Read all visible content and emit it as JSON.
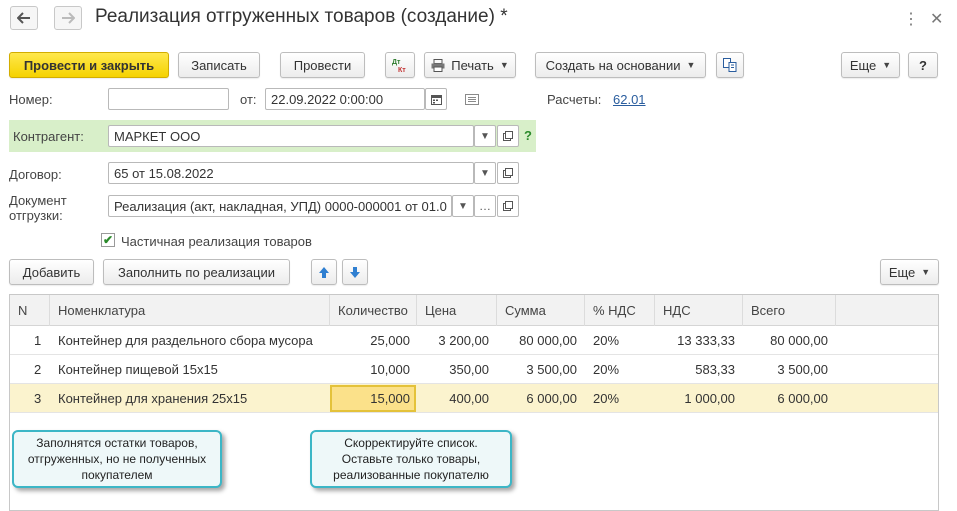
{
  "window": {
    "title": "Реализация отгруженных товаров (создание) *"
  },
  "toolbar": {
    "post_close": "Провести и закрыть",
    "save": "Записать",
    "post": "Провести",
    "dt_kt": "Дт Кт",
    "print": "Печать",
    "create_based": "Создать на основании",
    "more": "Еще",
    "help": "?"
  },
  "form": {
    "number_label": "Номер:",
    "number_value": "",
    "from_label": "от:",
    "date_value": "22.09.2022  0:00:00",
    "settlements_label": "Расчеты:",
    "settlements_value": "62.01",
    "counterparty_label": "Контрагент:",
    "counterparty_value": "МАРКЕТ ООО",
    "help_mark": "?",
    "contract_label": "Договор:",
    "contract_value": "65 от 15.08.2022",
    "shipdoc_label_1": "Документ",
    "shipdoc_label_2": "отгрузки:",
    "shipdoc_value": "Реализация (акт, накладная, УПД) 0000-000001 от 01.0",
    "partial_label": "Частичная реализация товаров",
    "partial_checked": true
  },
  "table_toolbar": {
    "add": "Добавить",
    "fill": "Заполнить по реализации",
    "more": "Еще"
  },
  "table": {
    "columns": [
      "N",
      "Номенклатура",
      "Количество",
      "Цена",
      "Сумма",
      "% НДС",
      "НДС",
      "Всего"
    ],
    "rows": [
      {
        "n": "1",
        "name": "Контейнер для раздельного сбора мусора",
        "qty": "25,000",
        "price": "3 200,00",
        "sum": "80 000,00",
        "vat_rate": "20%",
        "vat": "13 333,33",
        "total": "80 000,00"
      },
      {
        "n": "2",
        "name": "Контейнер пищевой 15х15",
        "qty": "10,000",
        "price": "350,00",
        "sum": "3 500,00",
        "vat_rate": "20%",
        "vat": "583,33",
        "total": "3 500,00"
      },
      {
        "n": "3",
        "name": "Контейнер для хранения 25х15",
        "qty": "15,000",
        "price": "400,00",
        "sum": "6 000,00",
        "vat_rate": "20%",
        "vat": "1 000,00",
        "total": "6 000,00"
      }
    ]
  },
  "callouts": {
    "left": "Заполнятся остатки товаров, отгруженных, но не полученных покупателем",
    "right": "Скорректируйте список. Оставьте только товары, реализованные покупателю"
  },
  "colors": {
    "primary_button": "#f5d200",
    "green_band": "#d8efc9",
    "selected_row": "#fbf3ce",
    "callout_border": "#3cb6c6",
    "link": "#2a5d9e"
  }
}
